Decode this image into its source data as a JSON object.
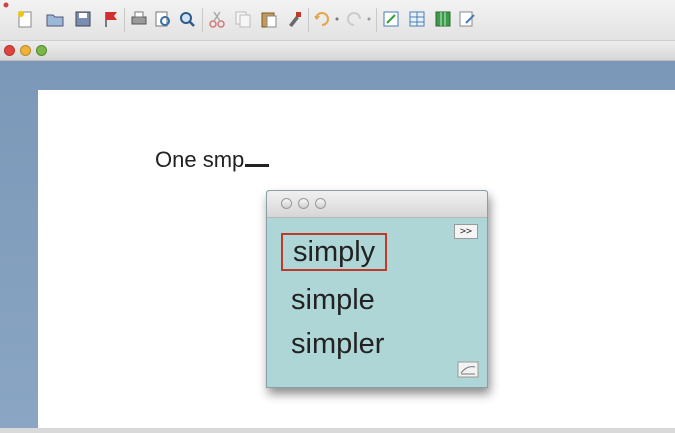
{
  "toolbar": {
    "icons": [
      "new-document",
      "open-folder",
      "save",
      "flag",
      "print",
      "print-preview",
      "zoom",
      "cut",
      "copy",
      "paste",
      "format-brush",
      "undo",
      "redo",
      "edit",
      "table",
      "columns",
      "drawing"
    ]
  },
  "window": {
    "controls": [
      "close",
      "minimize",
      "zoom"
    ]
  },
  "document": {
    "typed_text": "One smp"
  },
  "popup": {
    "more_label": ">>",
    "suggestions": [
      "simply",
      "simple",
      "simpler"
    ],
    "selected_index": 0
  },
  "colors": {
    "popup_bg": "#aed6d6",
    "selection_border": "#c0392b",
    "frame_blue": "#7c98b8"
  }
}
